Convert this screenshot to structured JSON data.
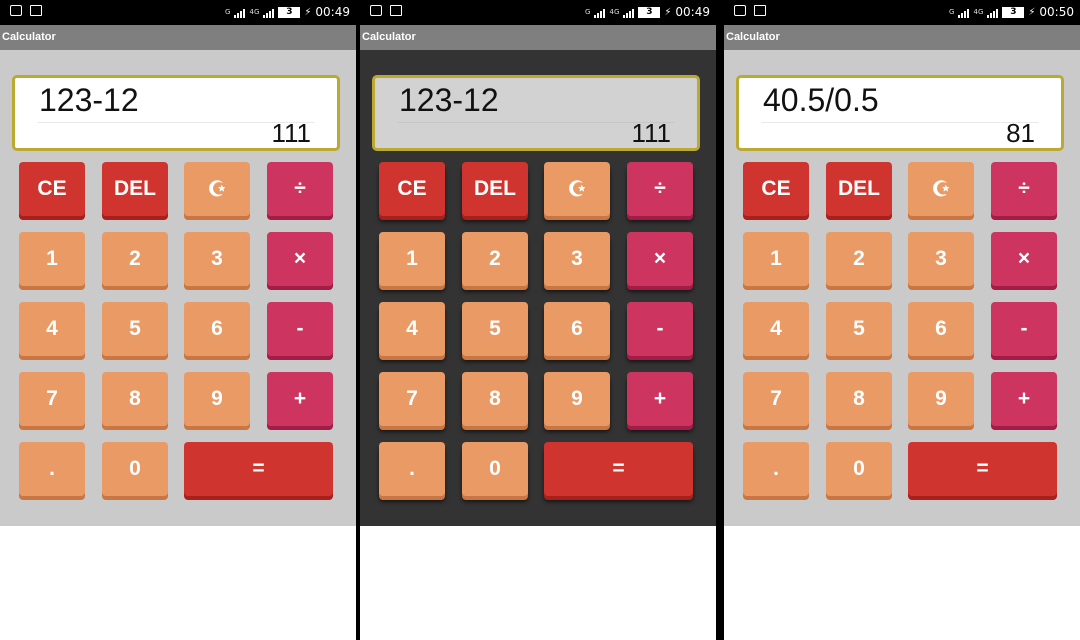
{
  "status": {
    "clocks": [
      "00:49",
      "00:49",
      "00:50"
    ],
    "battery": "3",
    "network_label": "4G"
  },
  "app": {
    "title": "Calculator"
  },
  "screens": [
    {
      "expression": "123-12",
      "result": "111"
    },
    {
      "expression": "123-12",
      "result": "111"
    },
    {
      "expression": "40.5/0.5",
      "result": "81"
    }
  ],
  "keys": {
    "clear": "CE",
    "delete": "DEL",
    "theme": "☪",
    "divide": "÷",
    "multiply": "×",
    "subtract": "-",
    "add": "+",
    "decimal": ".",
    "equals": "=",
    "digits": [
      "0",
      "1",
      "2",
      "3",
      "4",
      "5",
      "6",
      "7",
      "8",
      "9"
    ]
  },
  "colors": {
    "key_red": "#d0342f",
    "key_orange": "#ea9a64",
    "key_pink": "#cd3460",
    "display_border": "#bba932",
    "light_bg": "#cacaca",
    "dark_bg": "#333333",
    "titlebar": "#7e7f7e"
  }
}
